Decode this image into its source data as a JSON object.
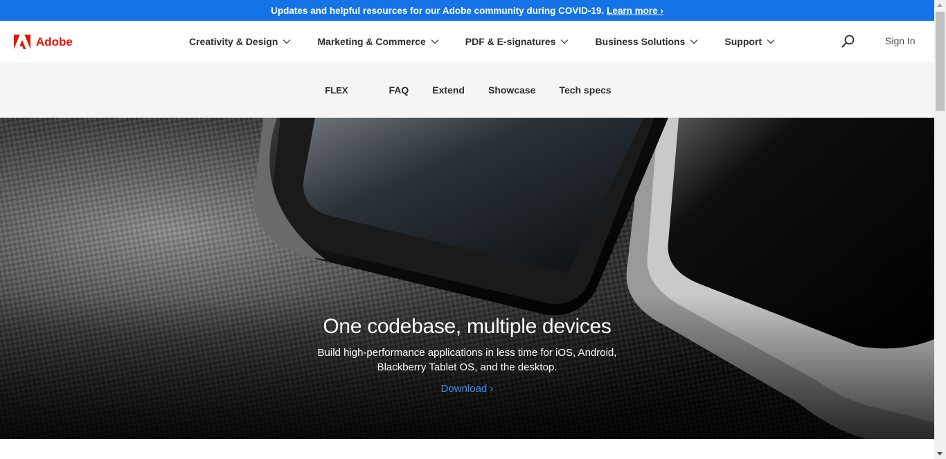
{
  "announcement": {
    "text": "Updates and helpful resources for our Adobe community during COVID-19.",
    "link": "Learn more ›"
  },
  "global_nav": {
    "logo_text": "Adobe",
    "menu": [
      {
        "label": "Creativity & Design"
      },
      {
        "label": "Marketing & Commerce"
      },
      {
        "label": "PDF & E-signatures"
      },
      {
        "label": "Business Solutions"
      },
      {
        "label": "Support"
      }
    ],
    "search_icon": "search-icon",
    "sign_in": "Sign In"
  },
  "local_nav": {
    "brand": "FLEX",
    "items": [
      {
        "label": "FAQ"
      },
      {
        "label": "Extend"
      },
      {
        "label": "Showcase"
      },
      {
        "label": "Tech specs"
      }
    ]
  },
  "hero": {
    "title": "One codebase, multiple devices",
    "description": "Build high-performance applications in less time for iOS, Android, Blackberry Tablet OS, and the desktop.",
    "cta": "Download ›"
  },
  "colors": {
    "announce_bg": "#1473e6",
    "adobe_red": "#eb1000",
    "link_blue": "#378ef0",
    "local_nav_bg": "#f5f5f5"
  }
}
